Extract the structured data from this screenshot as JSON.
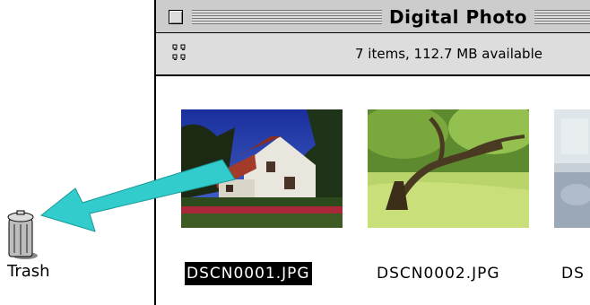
{
  "window": {
    "title": "Digital Photo",
    "status": "7 items, 112.7 MB available"
  },
  "files": [
    {
      "name": "DSCN0001.JPG",
      "selected": true
    },
    {
      "name": "DSCN0002.JPG",
      "selected": false
    },
    {
      "name": "DS",
      "selected": false
    }
  ],
  "desktop": {
    "trash_label": "Trash"
  },
  "colors": {
    "arrow": "#33cccc",
    "selection": "#000000",
    "titlebar": "#cccccc"
  },
  "icons": {
    "view": "icon-view-icon",
    "trash": "trash-icon",
    "close": "close-box-icon"
  }
}
